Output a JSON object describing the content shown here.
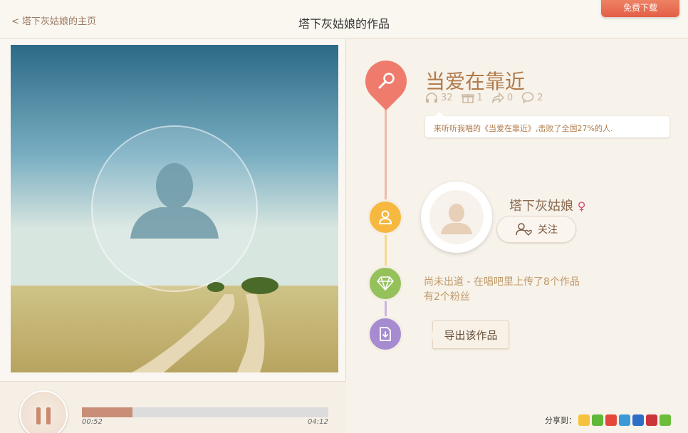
{
  "header": {
    "back_label": "< 塔下灰姑娘的主页",
    "title": "塔下灰姑娘的作品",
    "ribbon_label": "免费下载"
  },
  "player": {
    "current_time": "00:52",
    "total_time": "04:12",
    "progress": 0.206
  },
  "song": {
    "title": "当爱在靠近",
    "plays": "32",
    "gifts": "1",
    "shares": "0",
    "comments": "2",
    "description": "来听听我唱的《当爱在靠近》,击败了全国27%的人."
  },
  "user": {
    "name": "塔下灰姑娘",
    "gender_symbol": "♀",
    "follow_label": "关注",
    "status_line1": "尚未出道 - 在唱吧里上传了8个作品",
    "status_line2": "有2个粉丝"
  },
  "export": {
    "label": "导出该作品"
  },
  "share": {
    "label": "分享到：",
    "icons": [
      "qzone-icon",
      "wechat-icon",
      "weibo-icon",
      "tencent-weibo-icon",
      "renren-icon",
      "douban-icon",
      "more-share-icon"
    ]
  },
  "colors": {
    "accent_red": "#ef7b6d",
    "accent_yellow": "#f6b83e",
    "accent_green": "#95c15b",
    "accent_purple": "#a68bd1",
    "text_brown": "#b07a4a"
  }
}
